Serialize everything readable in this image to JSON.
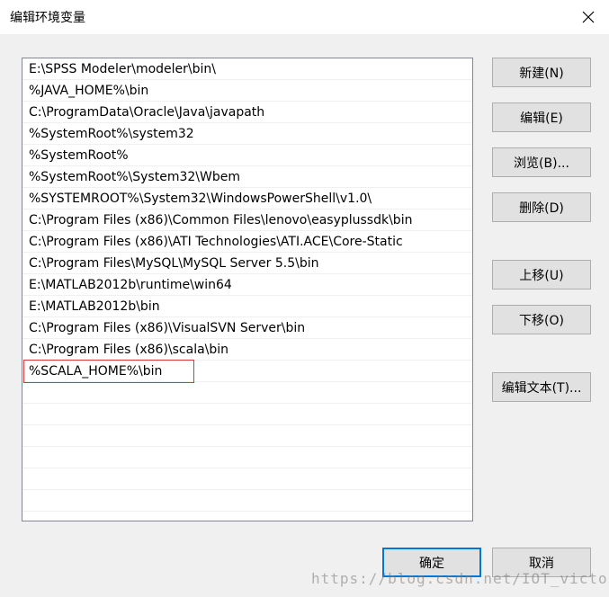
{
  "window": {
    "title": "编辑环境变量"
  },
  "list": {
    "items": [
      "E:\\SPSS Modeler\\modeler\\bin\\",
      "%JAVA_HOME%\\bin",
      "C:\\ProgramData\\Oracle\\Java\\javapath",
      "%SystemRoot%\\system32",
      "%SystemRoot%",
      "%SystemRoot%\\System32\\Wbem",
      "%SYSTEMROOT%\\System32\\WindowsPowerShell\\v1.0\\",
      "C:\\Program Files (x86)\\Common Files\\lenovo\\easyplussdk\\bin",
      "C:\\Program Files (x86)\\ATI Technologies\\ATI.ACE\\Core-Static",
      "C:\\Program Files\\MySQL\\MySQL Server 5.5\\bin",
      "E:\\MATLAB2012b\\runtime\\win64",
      "E:\\MATLAB2012b\\bin",
      "C:\\Program Files (x86)\\VisualSVN Server\\bin",
      "C:\\Program Files (x86)\\scala\\bin",
      "%SCALA_HOME%\\bin"
    ]
  },
  "buttons": {
    "new": "新建(N)",
    "edit": "编辑(E)",
    "browse": "浏览(B)...",
    "delete": "删除(D)",
    "move_up": "上移(U)",
    "move_down": "下移(O)",
    "edit_text": "编辑文本(T)...",
    "ok": "确定",
    "cancel": "取消"
  },
  "watermark": "https://blog.csdn.net/IOT_victor",
  "colors": {
    "highlight_border": "#d9383a",
    "default_button_border": "#0078d7"
  },
  "icons": {
    "close": "close-icon"
  }
}
